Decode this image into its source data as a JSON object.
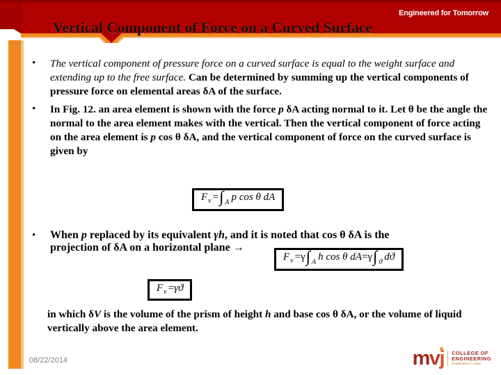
{
  "header": {
    "tagline": "Engineered for Tomorrow",
    "title": "Vertical Component of Force on a Curved Surface",
    "banner_color": "#B00000",
    "banner_dark_color": "#8E0000",
    "accent_color": "#F08A1E",
    "accent_light_color": "#F0C48C"
  },
  "bullets": [
    {
      "marker": "•",
      "italic_part": "The vertical component of pressure force on a curved surface is equal to the weight surface and extending up to the free surface.",
      "bold_part": " Can be determined by summing up the vertical components of pressure force on elemental areas δA of the surface."
    },
    {
      "marker": "•",
      "text_1": "In Fig. 12. an area element is shown with the force ",
      "var_p1": "p",
      "text_2": " δA acting normal to it. Let θ be the angle the normal to the area element makes with the vertical. Then the vertical component of force acting on the area element is ",
      "var_p2": "p",
      "text_3": " cos θ δA, and the vertical component of force on the curved surface is given by"
    },
    {
      "marker": "•",
      "text_1": "When ",
      "var_p": "p",
      "text_2": " replaced by its equivalent ",
      "var_gh": "γh",
      "text_3": ", and it is noted that cos θ δA is the projection of δA on a horizontal plane ",
      "arrow": "→"
    }
  ],
  "equations": {
    "eq1": {
      "lhs_F": "F",
      "lhs_sub": "v",
      "eq_sign": "=",
      "integral": "∫",
      "int_sub": "A",
      "body": "p cos θ dA"
    },
    "eq2": {
      "lhs_F": "F",
      "lhs_sub": "v",
      "eq_sign": "=",
      "gamma1": "γ",
      "integral1": "∫",
      "int_sub1": "A",
      "body1": "h cos θ dA",
      "eq_sign2": "=",
      "gamma2": "γ",
      "integral2": "∫",
      "int_sub2": "ϑ",
      "body2": "dϑ"
    },
    "eq3": {
      "lhs_F": "F",
      "lhs_sub": "v",
      "eq_sign": "=",
      "rhs": "γϑ"
    }
  },
  "closing": {
    "text_1": "in which δ",
    "var_V": "V",
    "text_2": " is the volume of the prism of height ",
    "var_h": "h",
    "text_3": " and base cos θ δA, or the volume of liquid vertically above the area element."
  },
  "footer": {
    "date": "08/22/2014",
    "logo": {
      "mark_m": "m",
      "mark_v": "v",
      "mark_j": "j",
      "line1": "COLLEGE OF",
      "line2": "ENGINEERING",
      "line3": "Established in 1982"
    }
  }
}
